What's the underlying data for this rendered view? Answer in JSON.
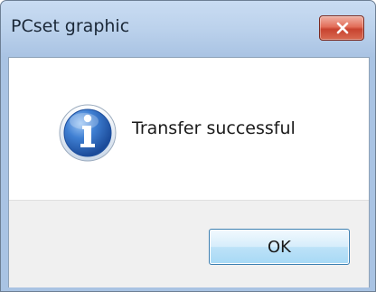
{
  "window": {
    "title": "PCset graphic"
  },
  "dialog": {
    "message": "Transfer successful",
    "icon": "information-icon"
  },
  "buttons": {
    "ok_label": "OK",
    "close_icon": "close-icon"
  },
  "colors": {
    "titlebar": "#bcd2ec",
    "close_button": "#d9533e",
    "ok_button": "#bde2f8",
    "info_icon": "#2a64b8"
  }
}
